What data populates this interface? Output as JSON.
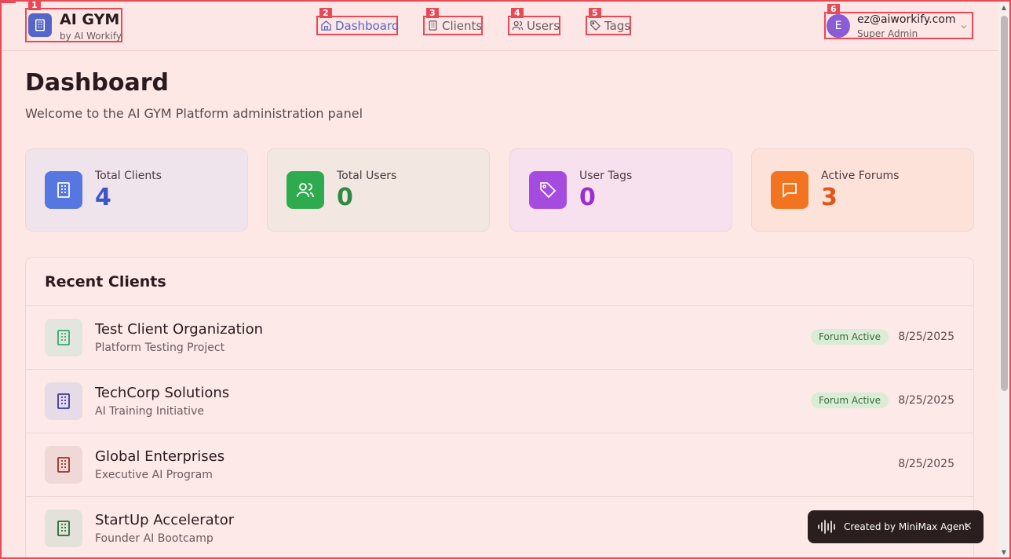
{
  "header": {
    "app_title": "AI GYM",
    "app_subtitle": "by AI Workify",
    "nav": {
      "dashboard": "Dashboard",
      "clients": "Clients",
      "users": "Users",
      "tags": "Tags"
    },
    "user": {
      "avatar_initial": "E",
      "email": "ez@aiworkify.com",
      "role": "Super Admin"
    }
  },
  "annotations": [
    "1",
    "2",
    "3",
    "4",
    "5",
    "6"
  ],
  "main": {
    "title": "Dashboard",
    "subtitle": "Welcome to the AI GYM Platform administration panel",
    "stats": [
      {
        "label": "Total Clients",
        "value": "4",
        "color": "#3d55c8",
        "icon_bg": "#5677e0",
        "card_bg": "#f0e4ec",
        "icon": "building-icon"
      },
      {
        "label": "Total Users",
        "value": "0",
        "color": "#2e8a3e",
        "icon_bg": "#2fab4f",
        "card_bg": "#f3e7e2",
        "icon": "users-icon"
      },
      {
        "label": "User Tags",
        "value": "0",
        "color": "#9a2fd0",
        "icon_bg": "#a64be0",
        "card_bg": "#f8e1ee",
        "icon": "tag-icon"
      },
      {
        "label": "Active Forums",
        "value": "3",
        "color": "#e2561a",
        "icon_bg": "#f27420",
        "card_bg": "#fde2da",
        "icon": "message-icon"
      }
    ],
    "recent_clients": {
      "title": "Recent Clients",
      "items": [
        {
          "name": "Test Client Organization",
          "description": "Platform Testing Project",
          "badge": "Forum Active",
          "date": "8/25/2025",
          "icon_color": "#3aa86a",
          "icon_bg": "#e3e6de"
        },
        {
          "name": "TechCorp Solutions",
          "description": "AI Training Initiative",
          "badge": "Forum Active",
          "date": "8/25/2025",
          "icon_color": "#3a3ab0",
          "icon_bg": "#e6dbe6"
        },
        {
          "name": "Global Enterprises",
          "description": "Executive AI Program",
          "badge": "",
          "date": "8/25/2025",
          "icon_color": "#9a3020",
          "icon_bg": "#efd8d6"
        },
        {
          "name": "StartUp Accelerator",
          "description": "Founder AI Bootcamp",
          "badge": "",
          "date": "",
          "icon_color": "#2a6a3a",
          "icon_bg": "#e3e2da"
        }
      ]
    }
  },
  "toast": {
    "text": "Created by MiniMax Agent",
    "close": "×"
  }
}
